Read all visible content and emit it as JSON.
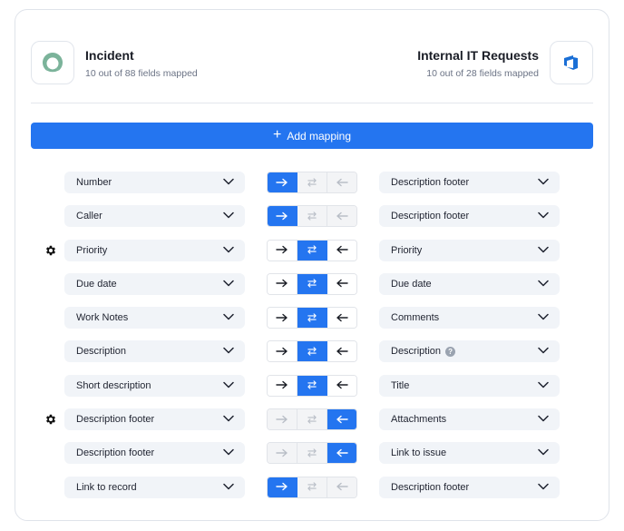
{
  "source": {
    "name": "Incident",
    "fields_mapped": "10 out of 88 fields mapped",
    "logo_icon": "servicenow-logo-icon",
    "logo_color": "#7bb39a"
  },
  "target": {
    "name": "Internal IT Requests",
    "fields_mapped": "10 out of 28 fields mapped",
    "logo_icon": "azure-devops-logo-icon",
    "logo_color": "#1a6fd6"
  },
  "add_mapping": {
    "label": "Add mapping",
    "icon": "plus-icon"
  },
  "colors": {
    "accent": "#2475f0",
    "field_bg": "#f1f4f8",
    "disabled_bg": "#f3f4f6"
  },
  "mappings": [
    {
      "left": "Number",
      "right": "Description footer",
      "direction": "to-right",
      "gear": false,
      "help": false
    },
    {
      "left": "Caller",
      "right": "Description footer",
      "direction": "to-right",
      "gear": false,
      "help": false
    },
    {
      "left": "Priority",
      "right": "Priority",
      "direction": "both",
      "gear": true,
      "help": false
    },
    {
      "left": "Due date",
      "right": "Due date",
      "direction": "both",
      "gear": false,
      "help": false
    },
    {
      "left": "Work Notes",
      "right": "Comments",
      "direction": "both",
      "gear": false,
      "help": false
    },
    {
      "left": "Description",
      "right": "Description",
      "direction": "both",
      "gear": false,
      "help": true
    },
    {
      "left": "Short description",
      "right": "Title",
      "direction": "both",
      "gear": false,
      "help": false
    },
    {
      "left": "Description footer",
      "right": "Attachments",
      "direction": "to-left",
      "gear": true,
      "help": false
    },
    {
      "left": "Description footer",
      "right": "Link to issue",
      "direction": "to-left",
      "gear": false,
      "help": false
    },
    {
      "left": "Link to record",
      "right": "Description footer",
      "direction": "to-right",
      "gear": false,
      "help": false
    }
  ]
}
